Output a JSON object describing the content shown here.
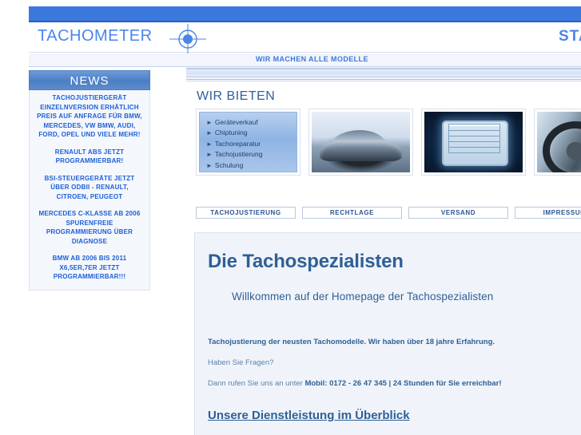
{
  "header": {
    "logo_text": "TACHOMETER",
    "logo_mark": "crosshair-target-icon",
    "brand_right": "STANDARD",
    "slogan": "WIR MACHEN ALLE MODELLE"
  },
  "sidebar": {
    "title": "NEWS",
    "blocks": [
      "TACHOJUSTIERGERÄT EINZELNVERSION ERHÄTLICH PREIS AUF ANFRAGE FÜR BMW, MERCEDES, VW BMW, AUDI, FORD, OPEL UND VIELE MEHR!",
      "RENAULT ABS JETZT PROGRAMMIERBAR!",
      "BSI-STEUERGERÄTE JETZT ÜBER ODBII - RENAULT, CITROEN, PEUGEOT",
      "MERCEDES C-KLASSE AB 2006 SPURENFREIE PROGRAMMIERUNG ÜBER DIAGNOSE",
      "BMW AB 2006 BIS 2011 X6,5ER,7ER JETZT PROGRAMMIERBAR!!!"
    ]
  },
  "offer": {
    "heading": "WIR BIETEN",
    "services": [
      "Geräteverkauf",
      "Chiptuning",
      "Tachoreparatur",
      "Tachojustierung",
      "Schulung"
    ],
    "bullet_glyph": "►",
    "images": [
      {
        "name": "car-photo",
        "alt": "Citroen C4 Limousine"
      },
      {
        "name": "device-screen-photo",
        "alt": "Tachojustiergerät Display"
      },
      {
        "name": "steering-wheel-photo",
        "alt": "Lenkrad und Armaturenbrett"
      }
    ]
  },
  "nav": {
    "items": [
      "TACHOJUSTIERUNG",
      "RECHTLAGE",
      "VERSAND",
      "IMPRESSUM"
    ]
  },
  "main": {
    "title": "Die Tachospezialisten",
    "welcome": "Willkommen auf der Homepage der Tachospezialisten",
    "intro": "Tachojustierung der neusten Tachomodelle. Wir haben über 18 jahre Erfahrung.",
    "question": "Haben Sie Fragen?",
    "call_prefix": "Dann rufen Sie uns an unter ",
    "call_bold": "Mobil: 0172 - 26 47 345 |  24 Stunden für Sie erreichbar!",
    "services_link": "Unsere Dienstleistung im Überblick"
  },
  "colors": {
    "band_blue": "#3b78dd",
    "logo_blue": "#4a86e8",
    "news_blue": "#1d5fd4",
    "heading_blue": "#2f6096",
    "body_blue": "#5b82aa",
    "panel_bg": "#f0f4fa"
  }
}
